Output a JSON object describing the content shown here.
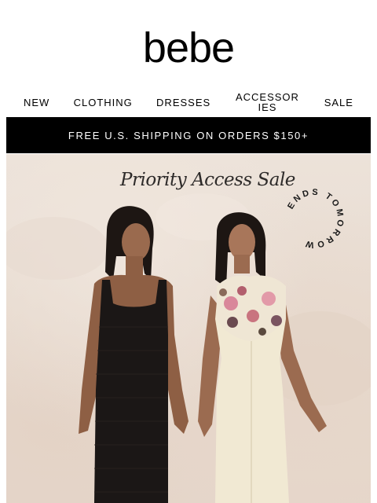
{
  "header": {
    "brand": "bebe"
  },
  "nav": {
    "items": [
      {
        "label": "NEW"
      },
      {
        "label": "CLOTHING"
      },
      {
        "label": "DRESSES"
      },
      {
        "label": "ACCESSORIES"
      },
      {
        "label": "SALE"
      }
    ]
  },
  "promo_banner": {
    "text": "FREE U.S. SHIPPING ON ORDERS $150+"
  },
  "hero": {
    "headline": "Priority Access Sale",
    "badge_text": "ENDS TOMORROW",
    "image_subject": "two models in black and cream dresses"
  }
}
